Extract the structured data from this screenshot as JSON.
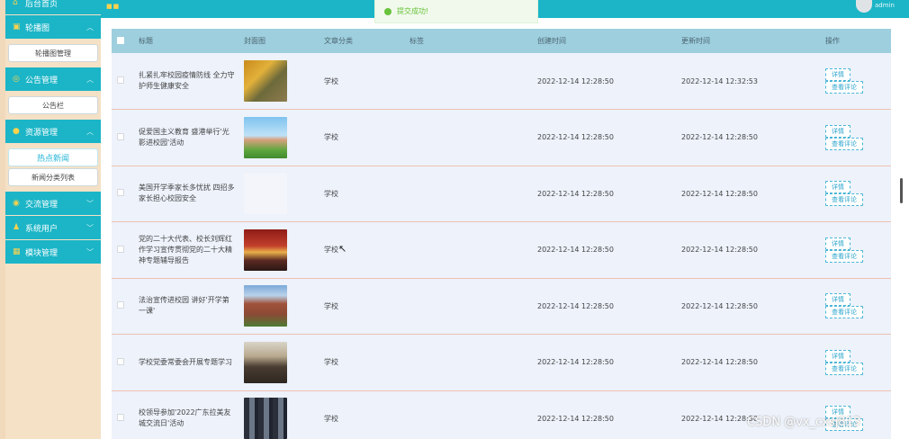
{
  "header": {
    "top_menu_label": "后台首页",
    "user_name": "admin",
    "toast": "提交成功!"
  },
  "sidebar": {
    "groups": [
      {
        "icon": "image-icon",
        "label": "轮播图",
        "items": [
          "轮播图管理"
        ]
      },
      {
        "icon": "notice-icon",
        "label": "公告管理",
        "items": [
          "公告栏"
        ]
      },
      {
        "icon": "location-icon",
        "label": "资源管理",
        "items": [
          "热点新闻",
          "新闻分类列表"
        ]
      },
      {
        "icon": "chat-icon",
        "label": "交流管理",
        "items": []
      },
      {
        "icon": "user-icon",
        "label": "系统用户",
        "items": []
      },
      {
        "icon": "grid-icon",
        "label": "模块管理",
        "items": []
      }
    ]
  },
  "table": {
    "columns": [
      "标题",
      "封面图",
      "文章分类",
      "标签",
      "创建时间",
      "更新时间",
      "操作"
    ],
    "actions": {
      "detail": "详情",
      "comments": "查看评论"
    },
    "rows": [
      {
        "title": "扎紧扎牢校园疫情防线 全力守护师生健康安全",
        "category": "学校",
        "tag": "",
        "created": "2022-12-14 12:28:50",
        "updated": "2022-12-14 12:32:53"
      },
      {
        "title": "促爱国主义教育 盛港举行'光影进校园'活动",
        "category": "学校",
        "tag": "",
        "created": "2022-12-14 12:28:50",
        "updated": "2022-12-14 12:28:50"
      },
      {
        "title": "美国开学季家长多忧扰 四招多家长担心校园安全",
        "category": "学校",
        "tag": "",
        "created": "2022-12-14 12:28:50",
        "updated": "2022-12-14 12:28:50"
      },
      {
        "title": "党的二十大代表、校长刘辉红作学习宣传贯彻党的二十大精神专题辅导报告",
        "category": "学校",
        "tag": "",
        "created": "2022-12-14 12:28:50",
        "updated": "2022-12-14 12:28:50"
      },
      {
        "title": "法治宣传进校园 讲好'开学第一课'",
        "category": "学校",
        "tag": "",
        "created": "2022-12-14 12:28:50",
        "updated": "2022-12-14 12:28:50"
      },
      {
        "title": "学校党委常委会开展专题学习",
        "category": "学校",
        "tag": "",
        "created": "2022-12-14 12:28:50",
        "updated": "2022-12-14 12:28:50"
      },
      {
        "title": "校领导参加'2022广东拉美友城交流日'活动",
        "category": "学校",
        "tag": "",
        "created": "2022-12-14 12:28:50",
        "updated": "2022-12-14 12:28:50"
      }
    ]
  },
  "watermark": "CSDN @vx_cxsj813",
  "colors": {
    "primary": "#1bb5c7",
    "sidebar_bg": "#f4e1c6",
    "header_row": "#9ecfde",
    "row_bg": "#edf2fb"
  }
}
